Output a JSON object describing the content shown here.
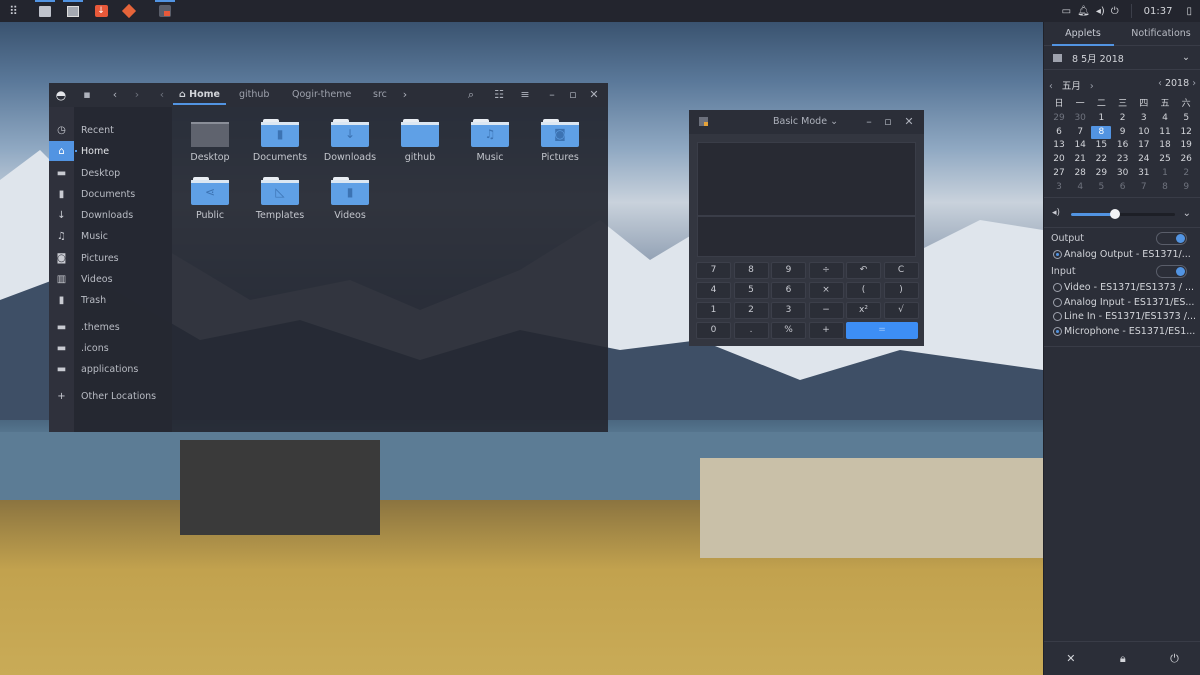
{
  "topbar": {
    "apps": [
      {
        "name": "app-grid",
        "icon": "grid-icon",
        "active": false
      },
      {
        "name": "files",
        "icon": "files-icon",
        "active": true
      },
      {
        "name": "terminal",
        "icon": "terminal-icon",
        "active": true
      },
      {
        "name": "installer",
        "icon": "download-app-icon",
        "active": false
      },
      {
        "name": "git",
        "icon": "git-icon",
        "active": false
      },
      {
        "name": "calculator",
        "icon": "calculator-icon",
        "active": true
      }
    ],
    "clock": "01:37"
  },
  "file_manager": {
    "breadcrumbs": [
      "Home",
      "github",
      "Qogir-theme",
      "src"
    ],
    "sidebar": [
      {
        "label": "Recent",
        "icon": "clock-icon",
        "glyph": "◷"
      },
      {
        "label": "Home",
        "icon": "home-icon",
        "glyph": "⌂",
        "selected": true
      },
      {
        "label": "Desktop",
        "icon": "desktop-icon",
        "glyph": "▬"
      },
      {
        "label": "Documents",
        "icon": "document-icon",
        "glyph": "▮"
      },
      {
        "label": "Downloads",
        "icon": "download-icon",
        "glyph": "↓"
      },
      {
        "label": "Music",
        "icon": "music-icon",
        "glyph": "♫"
      },
      {
        "label": "Pictures",
        "icon": "camera-icon",
        "glyph": "◙"
      },
      {
        "label": "Videos",
        "icon": "film-icon",
        "glyph": "▥"
      },
      {
        "label": "Trash",
        "icon": "trash-icon",
        "glyph": "▮"
      },
      {
        "label": ".themes",
        "icon": "folder-icon",
        "glyph": "▬"
      },
      {
        "label": ".icons",
        "icon": "folder-icon",
        "glyph": "▬"
      },
      {
        "label": "applications",
        "icon": "folder-icon",
        "glyph": "▬"
      },
      {
        "label": "Other Locations",
        "icon": "plus-icon",
        "glyph": "+"
      }
    ],
    "files": [
      {
        "name": "Desktop",
        "glyph": ""
      },
      {
        "name": "Documents",
        "glyph": "▮"
      },
      {
        "name": "Downloads",
        "glyph": "↓"
      },
      {
        "name": "github",
        "glyph": ""
      },
      {
        "name": "Music",
        "glyph": "♫"
      },
      {
        "name": "Pictures",
        "glyph": "◙"
      },
      {
        "name": "Public",
        "glyph": "⋖"
      },
      {
        "name": "Templates",
        "glyph": "◺"
      },
      {
        "name": "Videos",
        "glyph": "▮"
      }
    ]
  },
  "calculator": {
    "mode": "Basic Mode",
    "keys": [
      [
        "7",
        "8",
        "9",
        "÷",
        "↶",
        "C"
      ],
      [
        "4",
        "5",
        "6",
        "×",
        "(",
        ")"
      ],
      [
        "1",
        "2",
        "3",
        "−",
        "x²",
        "√"
      ],
      [
        "0",
        ".",
        "%",
        "+",
        "="
      ]
    ]
  },
  "panel": {
    "tabs": [
      "Applets",
      "Notifications"
    ],
    "date": "8 5月 2018",
    "month": "五月",
    "year": "2018",
    "weekdays": [
      "日",
      "一",
      "二",
      "三",
      "四",
      "五",
      "六"
    ],
    "weeks": [
      [
        "29",
        "30",
        "1",
        "2",
        "3",
        "4",
        "5"
      ],
      [
        "6",
        "7",
        "8",
        "9",
        "10",
        "11",
        "12"
      ],
      [
        "13",
        "14",
        "15",
        "16",
        "17",
        "18",
        "19"
      ],
      [
        "20",
        "21",
        "22",
        "23",
        "24",
        "25",
        "26"
      ],
      [
        "27",
        "28",
        "29",
        "30",
        "31",
        "1",
        "2"
      ],
      [
        "3",
        "4",
        "5",
        "6",
        "7",
        "8",
        "9"
      ]
    ],
    "today": "8",
    "volume_percent": 42,
    "output_label": "Output",
    "outputs": [
      {
        "label": "Analog Output - ES1371/...",
        "selected": true
      }
    ],
    "input_label": "Input",
    "inputs": [
      {
        "label": "Video - ES1371/ES1373 / ...",
        "selected": false
      },
      {
        "label": "Analog Input - ES1371/ES...",
        "selected": false
      },
      {
        "label": "Line In - ES1371/ES1373 /...",
        "selected": false
      },
      {
        "label": "Microphone - ES1371/ES1...",
        "selected": true
      }
    ]
  }
}
